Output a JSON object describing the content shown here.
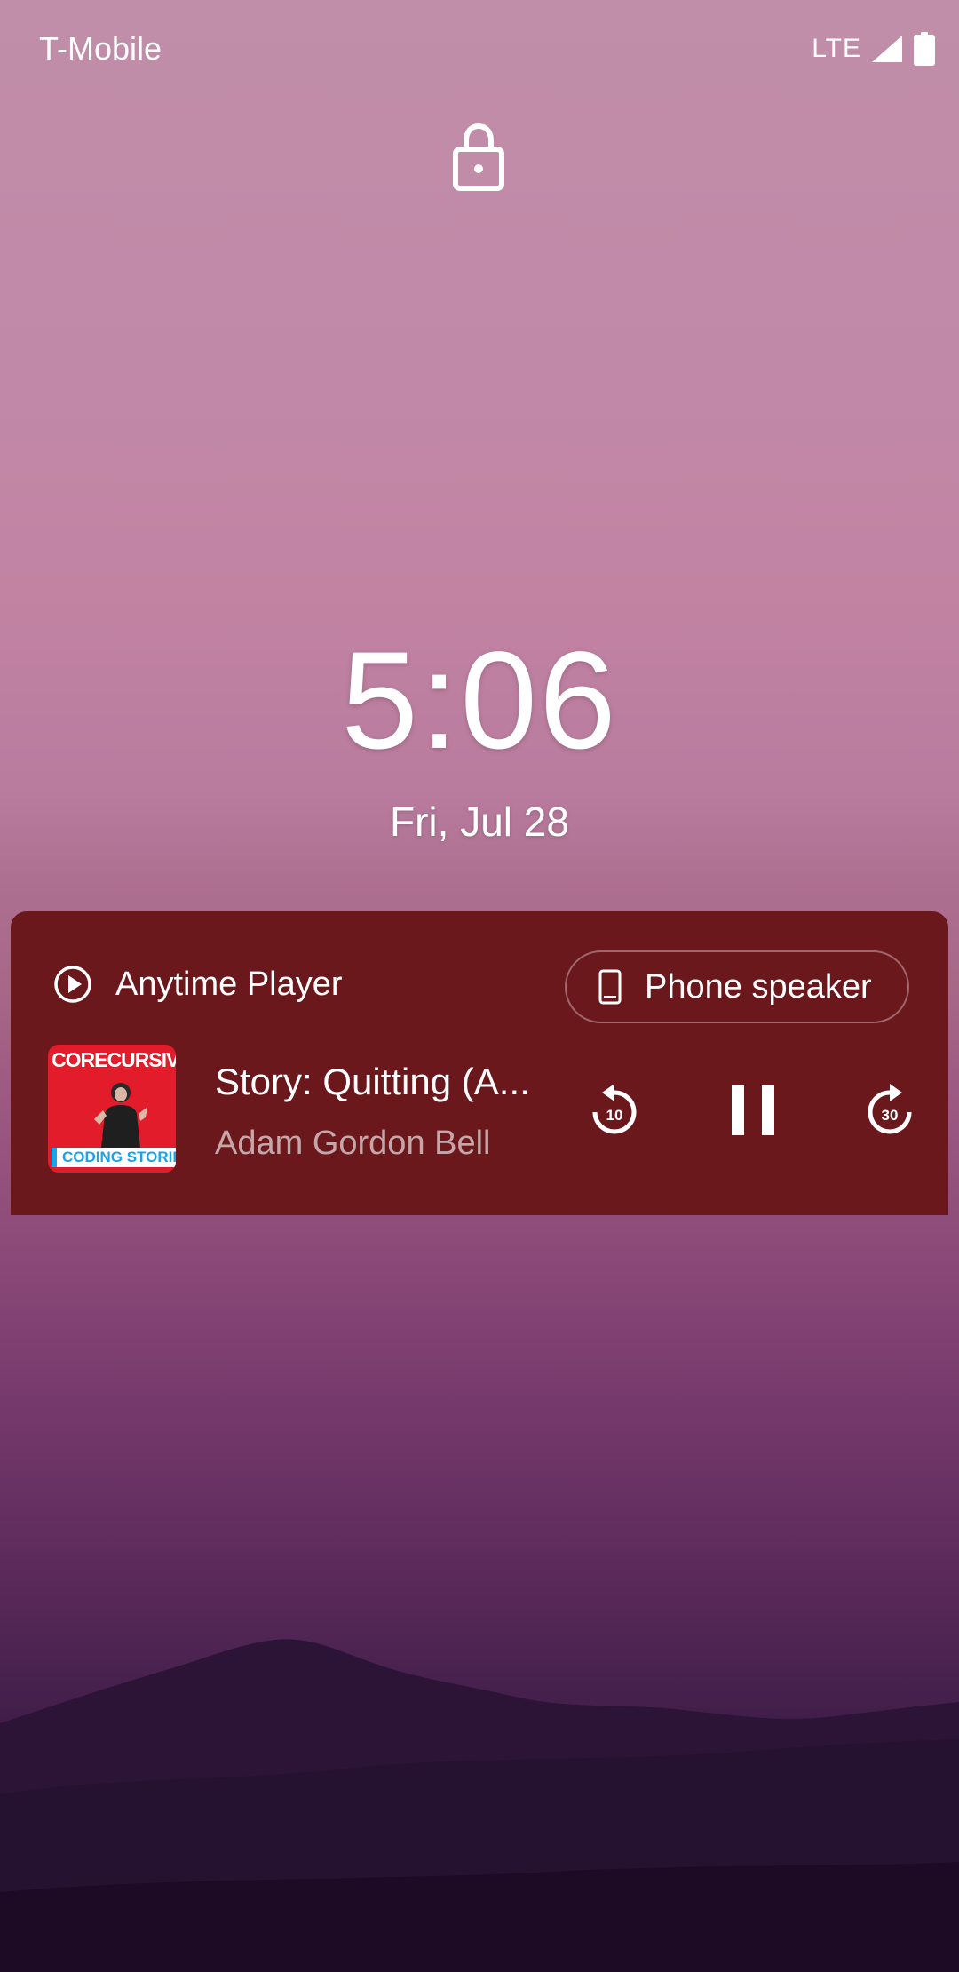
{
  "status_bar": {
    "carrier": "T-Mobile",
    "network": "LTE",
    "signal_icon": "cell-signal-icon",
    "battery_icon": "battery-icon"
  },
  "lockscreen": {
    "lock_icon": "lock-icon",
    "time": "5:06",
    "date": "Fri, Jul 28"
  },
  "media": {
    "app_icon": "play-circle-icon",
    "app_name": "Anytime Player",
    "output_icon": "phone-icon",
    "output_label": "Phone speaker",
    "artwork": {
      "top_text": "CORECURSIVE",
      "bottom_text": "CODING STORIES"
    },
    "title": "Story: Quitting (A...",
    "artist": "Adam Gordon Bell",
    "controls": {
      "rewind_label": "10",
      "forward_label": "30",
      "rewind_icon": "replay-10-icon",
      "pause_icon": "pause-icon",
      "forward_icon": "forward-30-icon"
    },
    "colors": {
      "card_background": "#6b181d",
      "artwork_red": "#e21c2a",
      "artwork_blue": "#1aa3e8"
    }
  }
}
